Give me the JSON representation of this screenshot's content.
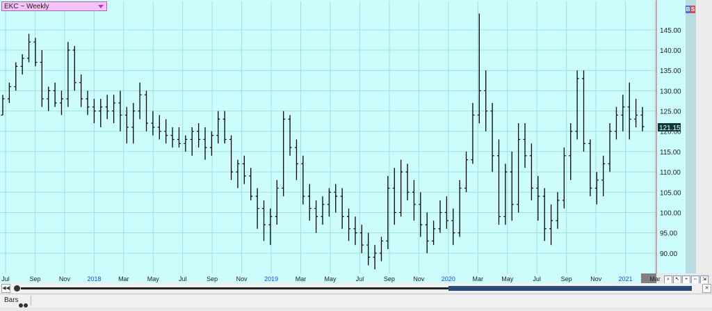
{
  "symbol": {
    "label": "EKC ~ Weekly"
  },
  "buttons": {
    "b": "B",
    "s": "S"
  },
  "bottom": {
    "bars_label": "Bars"
  },
  "last_price": "121.15",
  "colors": {
    "plot_bg": "#ccfcfc",
    "grid": "#9fe0e0",
    "bar": "#000000",
    "price_box": "#0a3a3a",
    "year_label": "#1a4acc",
    "cursor_line": "#e04040"
  },
  "chart_data": {
    "type": "ohlc",
    "title": "EKC ~ Weekly",
    "ylim": [
      85,
      152
    ],
    "yticks": [
      "145.00",
      "140.00",
      "135.00",
      "130.00",
      "125.00",
      "120.00",
      "115.00",
      "110.00",
      "105.00",
      "100.00",
      "95.00",
      "90.00"
    ],
    "x_labels": [
      {
        "label": "Jul",
        "year": false
      },
      {
        "label": "Sep",
        "year": false
      },
      {
        "label": "Nov",
        "year": false
      },
      {
        "label": "2018",
        "year": true
      },
      {
        "label": "Mar",
        "year": false
      },
      {
        "label": "May",
        "year": false
      },
      {
        "label": "Jul",
        "year": false
      },
      {
        "label": "Sep",
        "year": false
      },
      {
        "label": "Nov",
        "year": false
      },
      {
        "label": "2019",
        "year": true
      },
      {
        "label": "Mar",
        "year": false
      },
      {
        "label": "May",
        "year": false
      },
      {
        "label": "Jul",
        "year": false
      },
      {
        "label": "Sep",
        "year": false
      },
      {
        "label": "Nov",
        "year": false
      },
      {
        "label": "2020",
        "year": true
      },
      {
        "label": "Mar",
        "year": false
      },
      {
        "label": "May",
        "year": false
      },
      {
        "label": "Jul",
        "year": false
      },
      {
        "label": "Sep",
        "year": false
      },
      {
        "label": "Nov",
        "year": false
      },
      {
        "label": "2021",
        "year": true
      },
      {
        "label": "Mar",
        "year": false
      }
    ],
    "ohlc": [
      [
        124,
        129,
        124,
        128
      ],
      [
        128,
        132,
        127,
        131
      ],
      [
        131,
        137,
        130,
        136
      ],
      [
        136,
        139,
        134,
        138
      ],
      [
        138,
        144,
        137,
        142
      ],
      [
        142,
        143,
        136,
        137
      ],
      [
        137,
        140,
        126,
        128
      ],
      [
        128,
        131,
        125,
        130
      ],
      [
        130,
        132,
        126,
        127
      ],
      [
        127,
        130,
        124,
        128
      ],
      [
        128,
        142,
        126,
        140
      ],
      [
        140,
        141,
        130,
        132
      ],
      [
        132,
        134,
        126,
        128
      ],
      [
        128,
        130,
        124,
        126
      ],
      [
        126,
        128,
        122,
        125
      ],
      [
        125,
        128,
        121,
        126
      ],
      [
        126,
        129,
        123,
        125
      ],
      [
        125,
        129,
        122,
        127
      ],
      [
        127,
        130,
        120,
        124
      ],
      [
        124,
        126,
        117,
        121
      ],
      [
        121,
        127,
        117,
        125
      ],
      [
        125,
        132,
        123,
        129
      ],
      [
        129,
        130,
        120,
        122
      ],
      [
        122,
        125,
        119,
        121
      ],
      [
        121,
        124,
        118,
        120
      ],
      [
        120,
        123,
        117,
        119
      ],
      [
        119,
        121,
        116,
        118
      ],
      [
        118,
        121,
        116,
        117
      ],
      [
        117,
        119,
        115,
        118
      ],
      [
        118,
        121,
        114,
        120
      ],
      [
        120,
        122,
        116,
        118
      ],
      [
        118,
        121,
        113,
        116
      ],
      [
        116,
        120,
        114,
        119
      ],
      [
        119,
        125,
        117,
        123
      ],
      [
        123,
        125,
        117,
        118
      ],
      [
        118,
        119,
        108,
        110
      ],
      [
        110,
        113,
        106,
        112
      ],
      [
        112,
        114,
        107,
        109
      ],
      [
        109,
        111,
        103,
        104
      ],
      [
        104,
        106,
        96,
        101
      ],
      [
        101,
        103,
        93,
        97
      ],
      [
        97,
        101,
        92,
        99
      ],
      [
        99,
        108,
        97,
        106
      ],
      [
        106,
        125,
        104,
        123
      ],
      [
        123,
        124,
        114,
        116
      ],
      [
        116,
        118,
        108,
        112
      ],
      [
        112,
        114,
        102,
        104
      ],
      [
        104,
        107,
        98,
        101
      ],
      [
        101,
        103,
        95,
        99
      ],
      [
        99,
        104,
        97,
        102
      ],
      [
        102,
        106,
        99,
        105
      ],
      [
        105,
        107,
        100,
        104
      ],
      [
        104,
        106,
        96,
        99
      ],
      [
        99,
        101,
        93,
        96
      ],
      [
        96,
        99,
        92,
        95
      ],
      [
        95,
        97,
        90,
        92
      ],
      [
        92,
        95,
        87,
        89
      ],
      [
        89,
        92,
        86,
        90
      ],
      [
        90,
        94,
        88,
        93
      ],
      [
        93,
        109,
        91,
        106
      ],
      [
        106,
        111,
        97,
        100
      ],
      [
        100,
        113,
        99,
        110
      ],
      [
        110,
        112,
        103,
        105
      ],
      [
        105,
        108,
        98,
        102
      ],
      [
        102,
        105,
        94,
        97
      ],
      [
        97,
        100,
        90,
        93
      ],
      [
        93,
        98,
        92,
        96
      ],
      [
        96,
        103,
        95,
        100
      ],
      [
        100,
        104,
        96,
        98
      ],
      [
        98,
        101,
        92,
        95
      ],
      [
        95,
        108,
        94,
        106
      ],
      [
        106,
        115,
        105,
        113
      ],
      [
        113,
        127,
        112,
        124
      ],
      [
        124,
        149,
        122,
        130
      ],
      [
        130,
        135,
        120,
        125
      ],
      [
        125,
        127,
        110,
        114
      ],
      [
        114,
        118,
        97,
        99
      ],
      [
        99,
        112,
        97,
        110
      ],
      [
        110,
        115,
        98,
        102
      ],
      [
        102,
        122,
        100,
        118
      ],
      [
        118,
        122,
        111,
        114
      ],
      [
        114,
        117,
        103,
        106
      ],
      [
        106,
        109,
        98,
        104
      ],
      [
        104,
        106,
        93,
        96
      ],
      [
        96,
        102,
        92,
        98
      ],
      [
        98,
        105,
        96,
        103
      ],
      [
        103,
        116,
        101,
        114
      ],
      [
        114,
        122,
        108,
        120
      ],
      [
        120,
        135,
        118,
        133
      ],
      [
        133,
        135,
        115,
        117
      ],
      [
        117,
        118,
        104,
        106
      ],
      [
        106,
        110,
        102,
        108
      ],
      [
        108,
        114,
        104,
        112
      ],
      [
        112,
        122,
        110,
        120
      ],
      [
        120,
        126,
        118,
        124
      ],
      [
        124,
        129,
        120,
        126
      ],
      [
        126,
        132,
        118,
        123
      ],
      [
        123,
        128,
        121,
        124
      ],
      [
        124,
        126,
        120,
        121.15
      ]
    ]
  }
}
